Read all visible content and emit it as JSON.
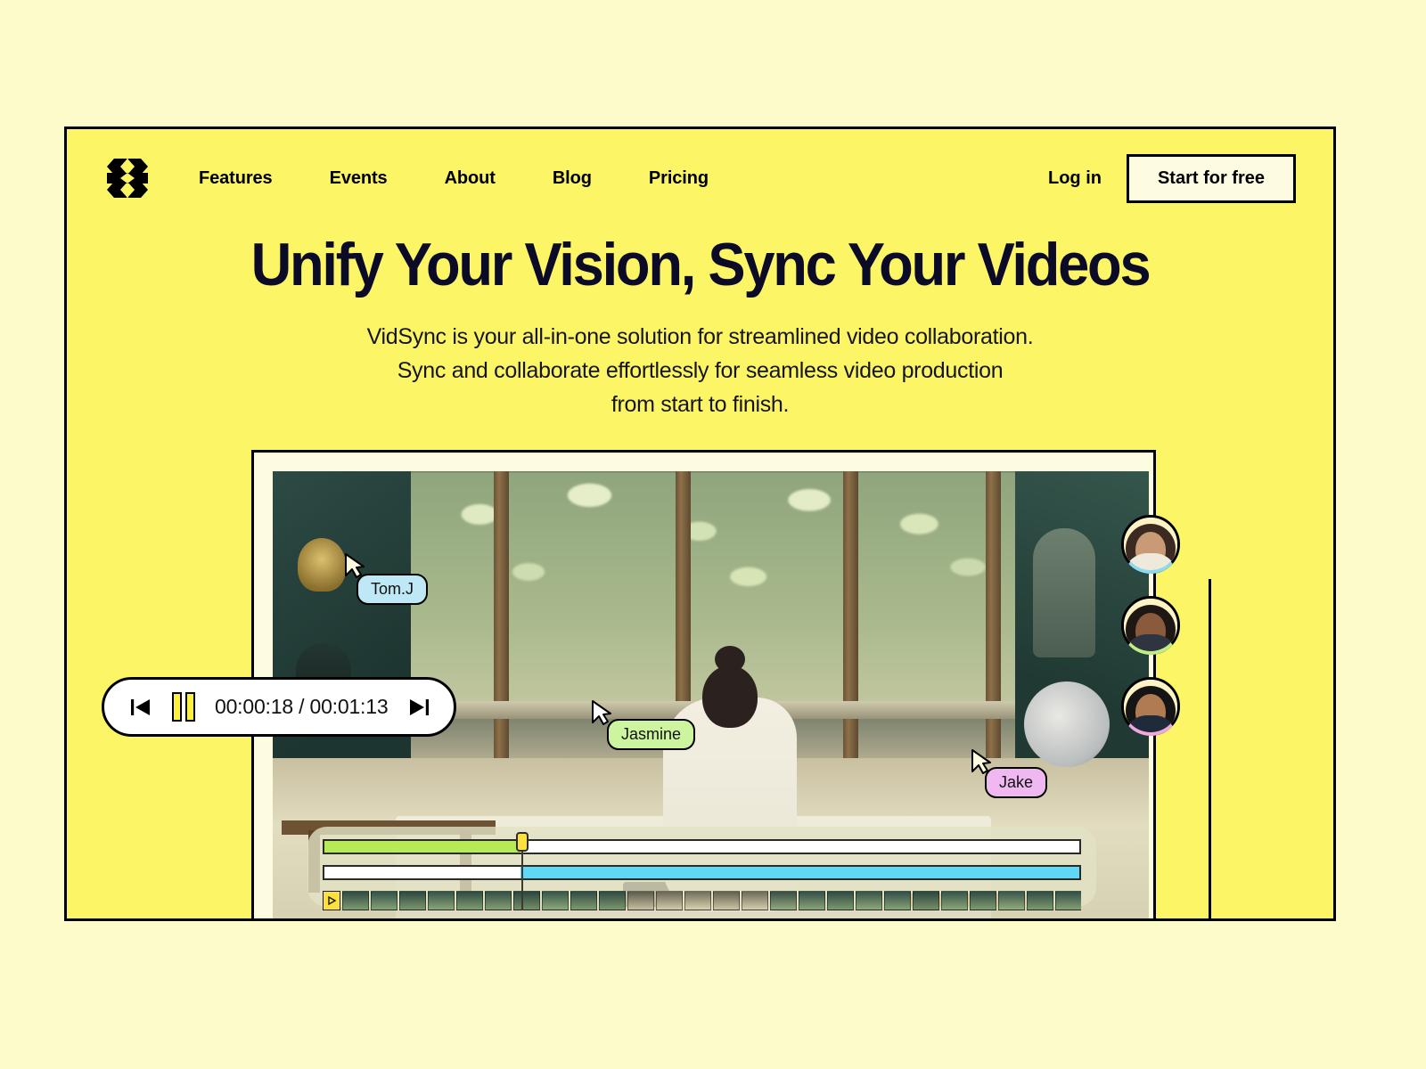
{
  "theme": {
    "page_background": "#FEFBCB",
    "card_background": "#FCF566",
    "accent_yellow": "#FCE13C",
    "ink": "#000000",
    "headline_color": "#0B0B28",
    "cta_background": "#FDFBE0"
  },
  "nav": {
    "logo_icon": "vidsync-hourglass-logo-icon",
    "links": [
      {
        "label": "Features"
      },
      {
        "label": "Events"
      },
      {
        "label": "About"
      },
      {
        "label": "Blog"
      },
      {
        "label": "Pricing"
      }
    ],
    "login_label": "Log in",
    "cta_label": "Start for free"
  },
  "hero": {
    "headline": "Unify Your Vision, Sync Your Videos",
    "subtitle_line1": "VidSync is your all-in-one solution for streamlined video collaboration.",
    "subtitle_line2": "Sync and collaborate effortlessly for seamless video production",
    "subtitle_line3": "from start to finish."
  },
  "player": {
    "prev_icon": "skip-back-icon",
    "pause_icon": "pause-icon",
    "next_icon": "skip-forward-icon",
    "current_time": "00:00:18",
    "total_time": "00:01:13",
    "time_display": "00:00:18 / 00:01:13"
  },
  "collaborators": [
    {
      "name": "Tom.J",
      "color": "#BEE8F5",
      "cursor_icon": "cursor-arrow-icon"
    },
    {
      "name": "Jasmine",
      "color": "#CDF5A0",
      "cursor_icon": "cursor-arrow-icon"
    },
    {
      "name": "Jake",
      "color": "#F0B8F0",
      "cursor_icon": "cursor-arrow-icon"
    }
  ],
  "avatars": [
    {
      "name": "Tom.J",
      "ring_color": "#8FD9F0",
      "hair": "#3a2a22",
      "skin": "#c99a76",
      "shirt": "#efe9dc"
    },
    {
      "name": "Jasmine",
      "ring_color": "#BFEE86",
      "hair": "#1f1714",
      "skin": "#8a5a3c",
      "shirt": "#2e3440"
    },
    {
      "name": "Jake",
      "ring_color": "#F0A8E0",
      "hair": "#151515",
      "skin": "#b07a52",
      "shirt": "#1f2a3a"
    }
  ],
  "timeline": {
    "playhead_position_percent": 26,
    "tracks": [
      {
        "name": "audio-track",
        "segments": [
          {
            "fill": "#B7EA57",
            "width_percent": 26
          },
          {
            "fill": "#FFFFFF",
            "width_percent": 74
          }
        ]
      },
      {
        "name": "caption-track",
        "segments": [
          {
            "fill": "#FFFFFF",
            "width_percent": 26
          },
          {
            "fill": "#5FD8F5",
            "width_percent": 74
          }
        ]
      }
    ],
    "filmstrip": {
      "play_icon": "play-triangle-icon",
      "frame_count": 27
    }
  }
}
